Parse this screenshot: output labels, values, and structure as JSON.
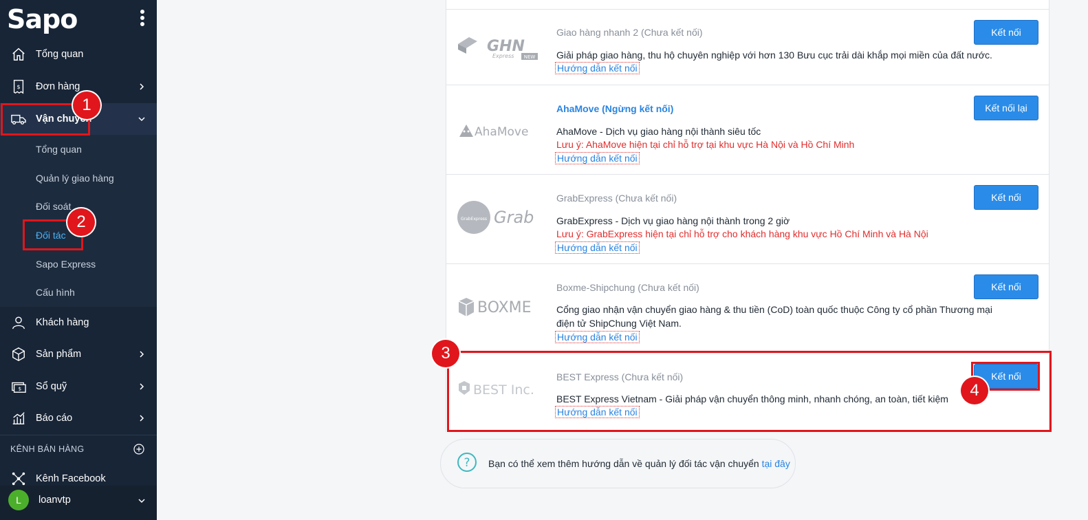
{
  "app": {
    "logo": "Sapo"
  },
  "sidebar": {
    "items": [
      {
        "label": "Tổng quan"
      },
      {
        "label": "Đơn hàng"
      },
      {
        "label": "Vận chuyển"
      },
      {
        "label": "Khách hàng"
      },
      {
        "label": "Sản phẩm"
      },
      {
        "label": "Sổ quỹ"
      },
      {
        "label": "Báo cáo"
      }
    ],
    "sub_items": [
      {
        "label": "Tổng quan"
      },
      {
        "label": "Quản lý giao hàng"
      },
      {
        "label": "Đối soát"
      },
      {
        "label": "Đối tác"
      },
      {
        "label": "Sapo Express"
      },
      {
        "label": "Cấu hình"
      }
    ],
    "channels_title": "KÊNH BÁN HÀNG",
    "channels": [
      {
        "label": "Kênh Facebook"
      }
    ],
    "user": {
      "initial": "L",
      "name": "loanvtp"
    }
  },
  "partners": [
    {
      "title": "Giao hàng nhanh 2 (Chưa kết nối)",
      "desc": "Giải pháp giao hàng, thu hộ chuyên nghiệp với hơn 130 Bưu cục trải dài khắp mọi miền của đất nước.",
      "note": "",
      "guide": "Hướng dẫn kết nối",
      "button": "Kết nối",
      "logo_text": "GHN",
      "logo_sub": "Express",
      "logo_tag": "NEW"
    },
    {
      "title": "AhaMove (Ngừng kết nối)",
      "desc": "AhaMove - Dịch vụ giao hàng nội thành siêu tốc",
      "note": "Lưu ý: AhaMove hiện tại chỉ hỗ trợ tại khu vực Hà Nội và Hồ Chí Minh",
      "guide": "Hướng dẫn kết nối",
      "button": "Kết nối lại",
      "logo_text": "AhaMove"
    },
    {
      "title": "GrabExpress (Chưa kết nối)",
      "desc": "GrabExpress - Dịch vụ giao hàng nội thành trong 2 giờ",
      "note": "Lưu ý: GrabExpress hiện tại chỉ hỗ trợ cho khách hàng khu vực Hồ Chí Minh và Hà Nội",
      "guide": "Hướng dẫn kết nối",
      "button": "Kết nối",
      "logo_text": "Grab",
      "logo_sub": "GrabExpress"
    },
    {
      "title": "Boxme-Shipchung (Chưa kết nối)",
      "desc": "Cổng giao nhận vận chuyển giao hàng & thu tiền (CoD) toàn quốc thuộc Công ty cổ phần Thương mại điện tử ShipChung Việt Nam.",
      "note": "",
      "guide": "Hướng dẫn kết nối",
      "button": "Kết nối",
      "logo_text": "BOXME"
    },
    {
      "title": "BEST Express (Chưa kết nối)",
      "desc": "BEST Express Vietnam - Giải pháp vận chuyển thông minh, nhanh chóng, an toàn, tiết kiệm",
      "note": "",
      "guide": "Hướng dẫn kết nối",
      "button": "Kết nối",
      "logo_text": "BEST Inc."
    }
  ],
  "help": {
    "text": "Bạn có thể xem thêm hướng dẫn về quản lý đối tác vận chuyển",
    "link": "tại đây"
  },
  "annotations": [
    "1",
    "2",
    "3",
    "4"
  ],
  "colors": {
    "sidebar_bg": "#182537",
    "accent": "#2a8ce8",
    "annotation_red": "#e0161c",
    "link": "#2a84e0"
  }
}
